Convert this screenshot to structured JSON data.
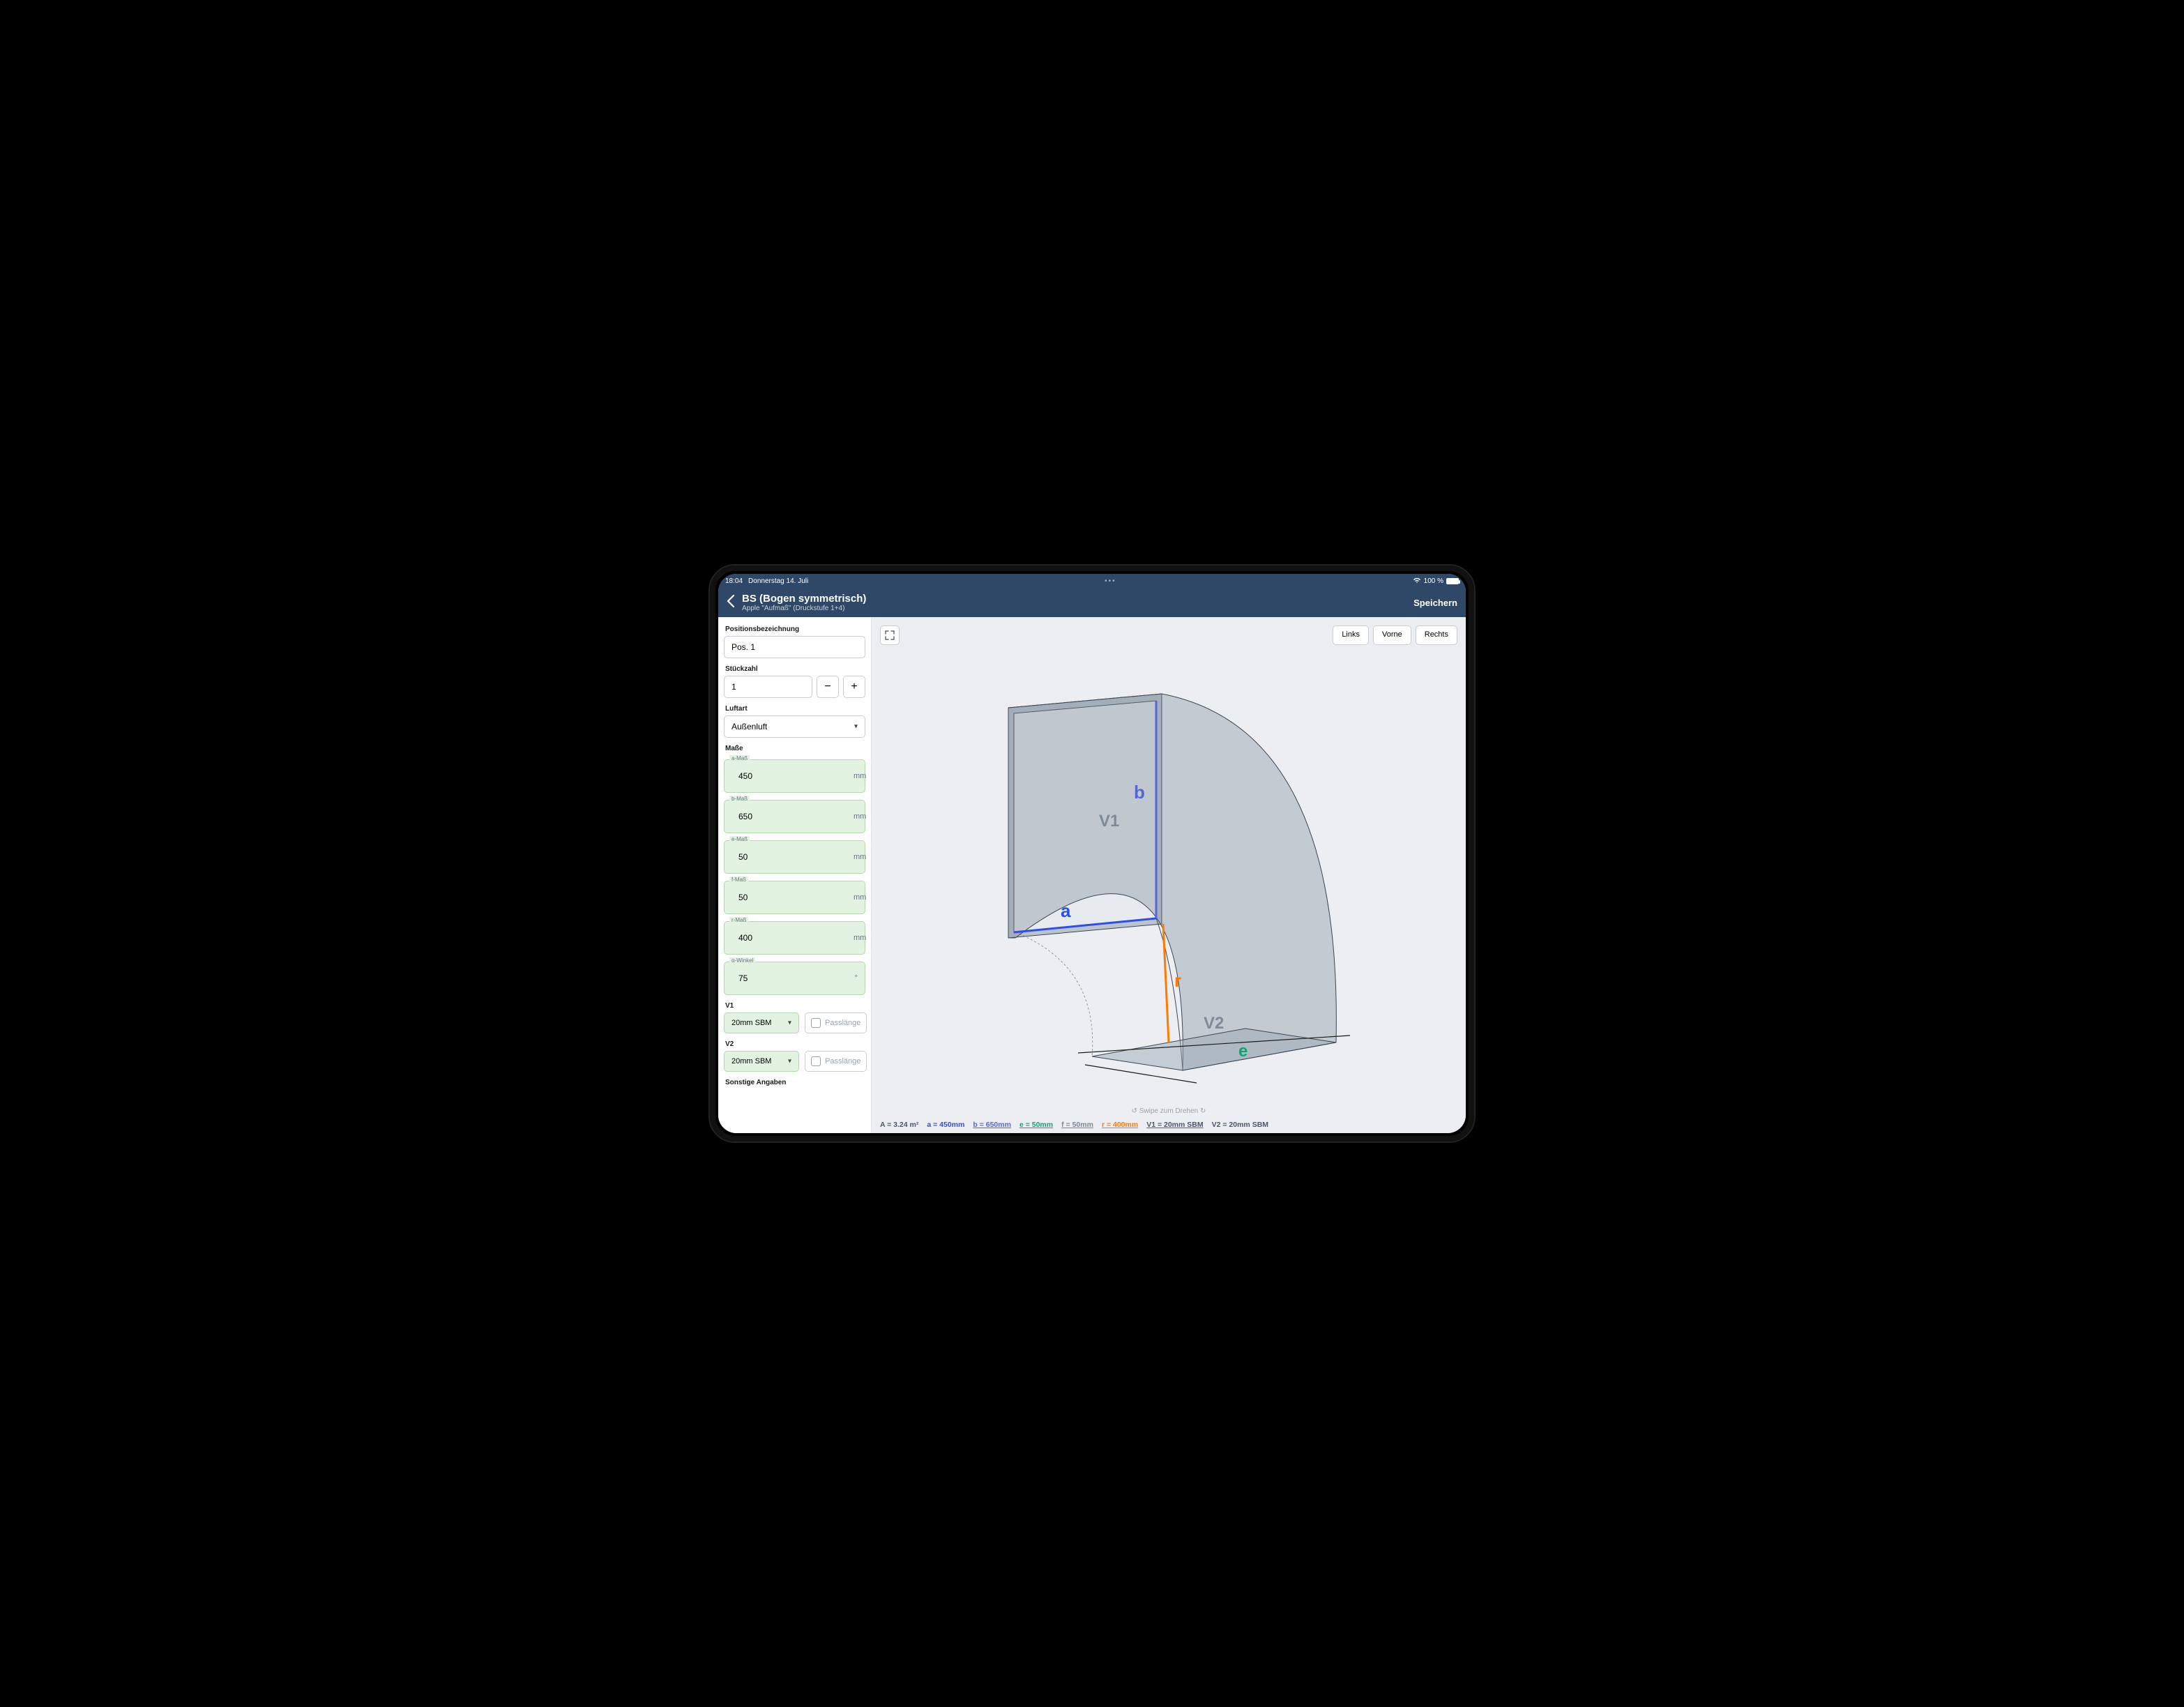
{
  "statusbar": {
    "time": "18:04",
    "date": "Donnerstag 14. Juli",
    "battery": "100 %"
  },
  "header": {
    "title": "BS (Bogen symmetrisch)",
    "subtitle": "Apple \"Aufmaß\" (Druckstufe 1+4)",
    "save": "Speichern"
  },
  "sidebar": {
    "pos_label": "Positionsbezeichnung",
    "pos_value": "Pos. 1",
    "qty_label": "Stückzahl",
    "qty_value": "1",
    "air_label": "Luftart",
    "air_value": "Außenluft",
    "dim_label": "Maße",
    "dims": {
      "a": {
        "legend": "a-Maß",
        "value": "450",
        "unit": "mm"
      },
      "b": {
        "legend": "b-Maß",
        "value": "650",
        "unit": "mm"
      },
      "e": {
        "legend": "e-Maß",
        "value": "50",
        "unit": "mm"
      },
      "f": {
        "legend": "f-Maß",
        "value": "50",
        "unit": "mm"
      },
      "r": {
        "legend": "r-Maß",
        "value": "400",
        "unit": "mm"
      },
      "alpha": {
        "legend": "α-Winkel",
        "value": "75",
        "unit": "°"
      }
    },
    "v1_label": "V1",
    "v1_select": "20mm SBM",
    "v2_label": "V2",
    "v2_select": "20mm SBM",
    "pass_label": "Passlänge",
    "other_label": "Sonstige Angaben"
  },
  "viewport": {
    "buttons": {
      "links": "Links",
      "vorne": "Vorne",
      "rechts": "Rechts"
    },
    "swipe": "↺ Swipe zum Drehen ↻",
    "annot": {
      "a": "a",
      "b": "b",
      "r": "r",
      "e": "e",
      "v1": "V1",
      "v2": "V2"
    },
    "bottom": {
      "area": "A = 3.24 m²",
      "a": "a = 450mm",
      "b": "b = 650mm",
      "e": "e = 50mm",
      "f": "f = 50mm",
      "r": "r = 400mm",
      "v1": "V1 = 20mm SBM",
      "v2": "V2 = 20mm SBM"
    }
  }
}
